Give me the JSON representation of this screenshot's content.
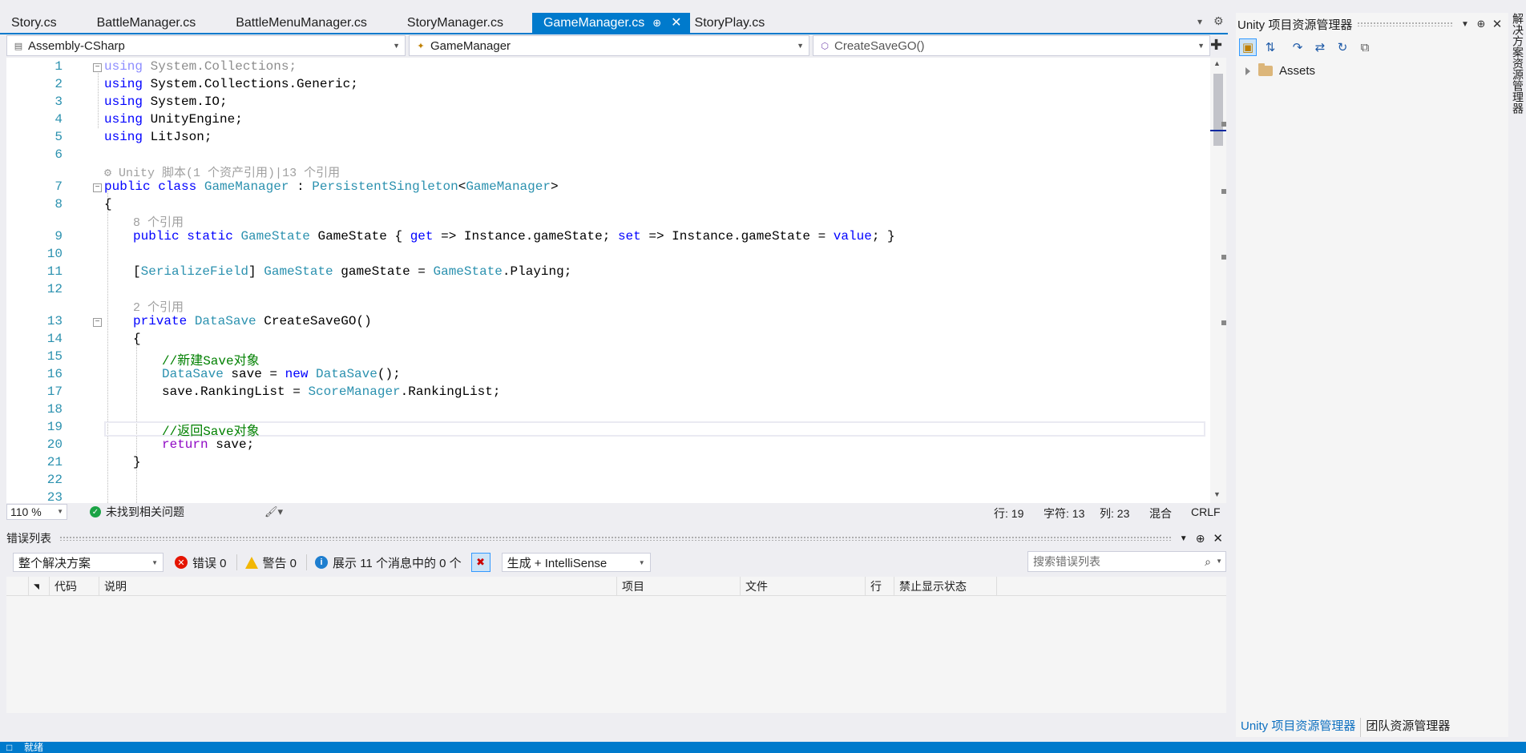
{
  "tabs": [
    {
      "label": "Story.cs",
      "active": false
    },
    {
      "label": "BattleManager.cs",
      "active": false
    },
    {
      "label": "BattleMenuManager.cs",
      "active": false
    },
    {
      "label": "StoryManager.cs",
      "active": false
    },
    {
      "label": "GameManager.cs",
      "active": true
    },
    {
      "label": "StoryPlay.cs",
      "active": false
    }
  ],
  "navbar": {
    "project": "Assembly-CSharp",
    "class": "GameManager",
    "member": "CreateSaveGO()"
  },
  "editor": {
    "line_numbers": [
      "1",
      "2",
      "3",
      "4",
      "5",
      "6",
      "7",
      "8",
      "9",
      "10",
      "11",
      "12",
      "13",
      "14",
      "15",
      "16",
      "17",
      "18",
      "19",
      "20",
      "21",
      "22",
      "23"
    ],
    "lens_unity": "Unity 脚本(1 个资产引用)|13 个引用",
    "lens_8refs": "8 个引用",
    "lens_2refs": "2 个引用",
    "lines": {
      "l1": {
        "kw": "using",
        "rest": " System.Collections;"
      },
      "l2": {
        "kw": "using",
        "rest": " System.Collections.Generic;"
      },
      "l3": {
        "kw": "using",
        "rest": " System.IO;"
      },
      "l4": {
        "kw": "using",
        "rest": " UnityEngine;"
      },
      "l5": {
        "kw": "using",
        "rest": " LitJson;"
      },
      "l7": {
        "kw1": "public",
        "kw2": "class",
        "name": "GameManager",
        "colon": " : ",
        "base": "PersistentSingleton",
        "lt": "<",
        "arg": "GameManager",
        "gt": ">"
      },
      "l8": "{",
      "l9": {
        "kw1": "public",
        "kw2": "static",
        "type": "GameState",
        "name": " GameState { ",
        "get": "get",
        "arrow1": " => Instance.gameState; ",
        "set": "set",
        "arrow2": " => Instance.gameState = ",
        "value": "value",
        "end": "; }"
      },
      "l11": {
        "attr_open": "[",
        "attr": "SerializeField",
        "attr_close": "] ",
        "type": "GameState",
        "mid": " gameState = ",
        "type2": "GameState",
        "end": ".Playing;"
      },
      "l13": {
        "kw": "private",
        "type": "DataSave",
        "rest": " CreateSaveGO()"
      },
      "l14": "{",
      "l15": "//新建Save对象",
      "l16": {
        "type": "DataSave",
        "mid": " save = ",
        "kw": "new",
        "sp": " ",
        "type2": "DataSave",
        "end": "();"
      },
      "l17": {
        "pre": "save.RankingList = ",
        "type": "ScoreManager",
        "end": ".RankingList;"
      },
      "l19": "//返回Save对象",
      "l20": {
        "kw": "return",
        "rest": " save;"
      },
      "l21": "}"
    }
  },
  "editor_status": {
    "zoom": "110 %",
    "issues": "未找到相关问题",
    "line": "行: 19",
    "char": "字符: 13",
    "col": "列: 23",
    "mixed": "混合",
    "eol": "CRLF"
  },
  "error_list": {
    "title": "错误列表",
    "scope": "整个解决方案",
    "errors": "错误 0",
    "warnings": "警告 0",
    "messages": "展示 11 个消息中的 0 个",
    "build_filter": "生成 + IntelliSense",
    "search_placeholder": "搜索错误列表",
    "columns": [
      "代码",
      "说明",
      "项目",
      "文件",
      "行",
      "禁止显示状态"
    ]
  },
  "solution_explorer": {
    "title": "Unity 项目资源管理器",
    "tree": [
      {
        "label": "Assets"
      }
    ],
    "bottom_tabs": [
      "Unity 项目资源管理器",
      "团队资源管理器"
    ]
  },
  "side_tab": "解决方案资源管理器",
  "status_bar": {
    "text": "就绪"
  },
  "colors": {
    "accent": "#007acc",
    "keyword": "#0000ff",
    "type": "#2b91af",
    "comment": "#008000",
    "control": "#8f08c4"
  }
}
